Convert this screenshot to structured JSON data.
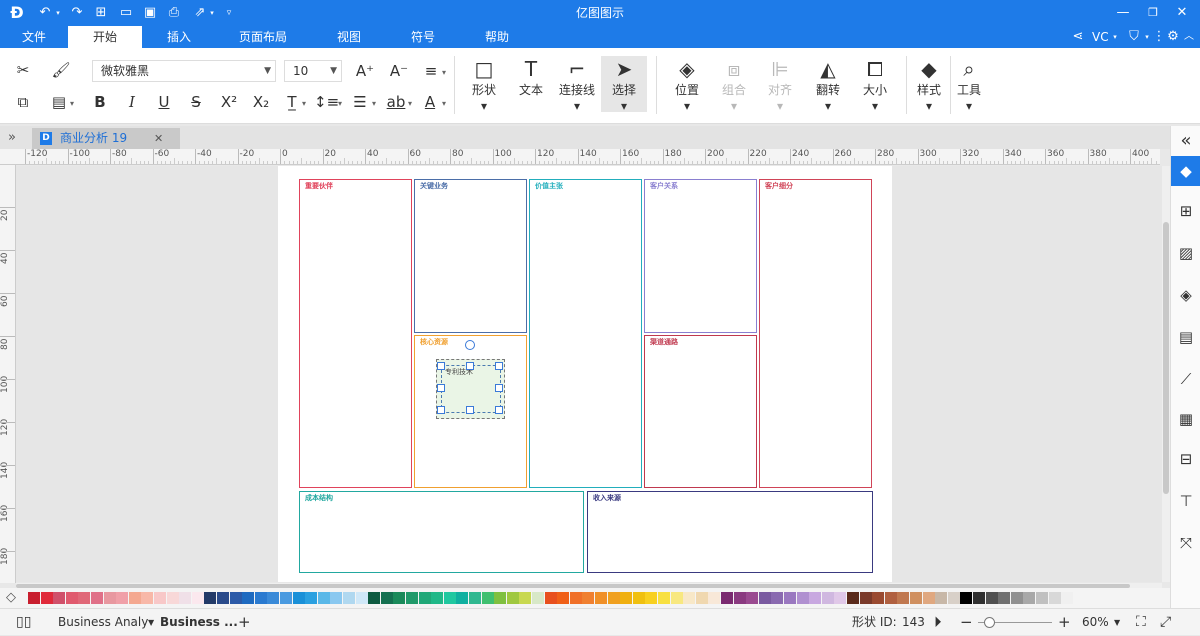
{
  "app": {
    "title": "亿图图示",
    "user": "VC"
  },
  "menu": {
    "items": [
      "文件",
      "开始",
      "插入",
      "页面布局",
      "视图",
      "符号",
      "帮助"
    ],
    "active_index": 1
  },
  "ribbon": {
    "font_name": "微软雅黑",
    "font_size": "10",
    "big_buttons": {
      "shape": "形状",
      "text": "文本",
      "connector": "连接线",
      "select": "选择",
      "position": "位置",
      "group": "组合",
      "align": "对齐",
      "flip": "翻转",
      "size": "大小",
      "style": "样式",
      "tools": "工具"
    }
  },
  "tab": {
    "doc_title": "商业分析 19"
  },
  "ruler": {
    "h_labels": [
      "-120",
      "-100",
      "-80",
      "-60",
      "-40",
      "-20",
      "0",
      "20",
      "40",
      "60",
      "80",
      "100",
      "120",
      "140",
      "160",
      "180",
      "200",
      "220",
      "240",
      "260",
      "280",
      "300",
      "320",
      "340",
      "360",
      "380",
      "400"
    ],
    "v_labels": [
      "20",
      "40",
      "60",
      "80",
      "100",
      "120",
      "140",
      "160",
      "180"
    ]
  },
  "canvas": {
    "boxes": {
      "key_partners": "重要伙伴",
      "key_activities": "关键业务",
      "value_propositions": "价值主张",
      "customer_relationships": "客户关系",
      "customer_segments": "客户细分",
      "key_resources": "核心资源",
      "channels": "渠道通路",
      "cost_structure": "成本结构",
      "revenue_streams": "收入来源"
    },
    "selected_shape_text": "专利技术",
    "colors": {
      "key_partners": "#e0435b",
      "key_activities": "#4b6ea8",
      "value_propositions": "#22aebc",
      "customer_relationships": "#8a7fd0",
      "customer_segments": "#d04457",
      "key_resources": "#f0a030",
      "channels": "#c0394f",
      "cost_structure": "#22a8a0",
      "revenue_streams": "#3a3a80"
    }
  },
  "palette": [
    "#c81e2e",
    "#e02a3a",
    "#d0506a",
    "#e05a6e",
    "#e06878",
    "#e07088",
    "#e898a0",
    "#f0a0a8",
    "#f4a890",
    "#f8b8a8",
    "#f8c8c8",
    "#f8d8d8",
    "#f0e0e8",
    "#fbe8ee",
    "#233a68",
    "#2a4a8a",
    "#2c5aa8",
    "#1e6ac0",
    "#2a7ad0",
    "#3a8ad8",
    "#4a9ae0",
    "#1a90d8",
    "#2aa0e0",
    "#5ab8e8",
    "#8ac8f0",
    "#b0d8f0",
    "#d0e8f8",
    "#0e5a40",
    "#147050",
    "#1a8a5a",
    "#209a6a",
    "#20a878",
    "#20b888",
    "#20c8a0",
    "#10b0a0",
    "#30b890",
    "#40c070",
    "#80c040",
    "#a0c840",
    "#c8d850",
    "#d8e8c8",
    "#e8501e",
    "#f06018",
    "#f07028",
    "#f08030",
    "#f09028",
    "#f0a020",
    "#f0b010",
    "#f0c010",
    "#f8d020",
    "#f8e040",
    "#f8e880",
    "#f8e8c8",
    "#f0d8b0",
    "#f8e8d8",
    "#7a2a70",
    "#8a3a80",
    "#9a4a90",
    "#7a5aa0",
    "#8a6ab0",
    "#9a78c0",
    "#b090d0",
    "#c8a8e0",
    "#d0b8e0",
    "#e0c8e8",
    "#5a2a1a",
    "#7a3a2a",
    "#9a4a30",
    "#b06040",
    "#c07850",
    "#d09060",
    "#e0a880",
    "#c8b8a8",
    "#d8d0c8",
    "#000000",
    "#303030",
    "#505050",
    "#707070",
    "#909090",
    "#a8a8a8",
    "#c0c0c0",
    "#d8d8d8",
    "#f0f0f0"
  ],
  "status": {
    "page_tab_1": "Business Analysi",
    "page_tab_2": "Business ...",
    "add": "+",
    "shape_id_label": "形状 ID:",
    "shape_id": "143",
    "zoom": "60%"
  }
}
